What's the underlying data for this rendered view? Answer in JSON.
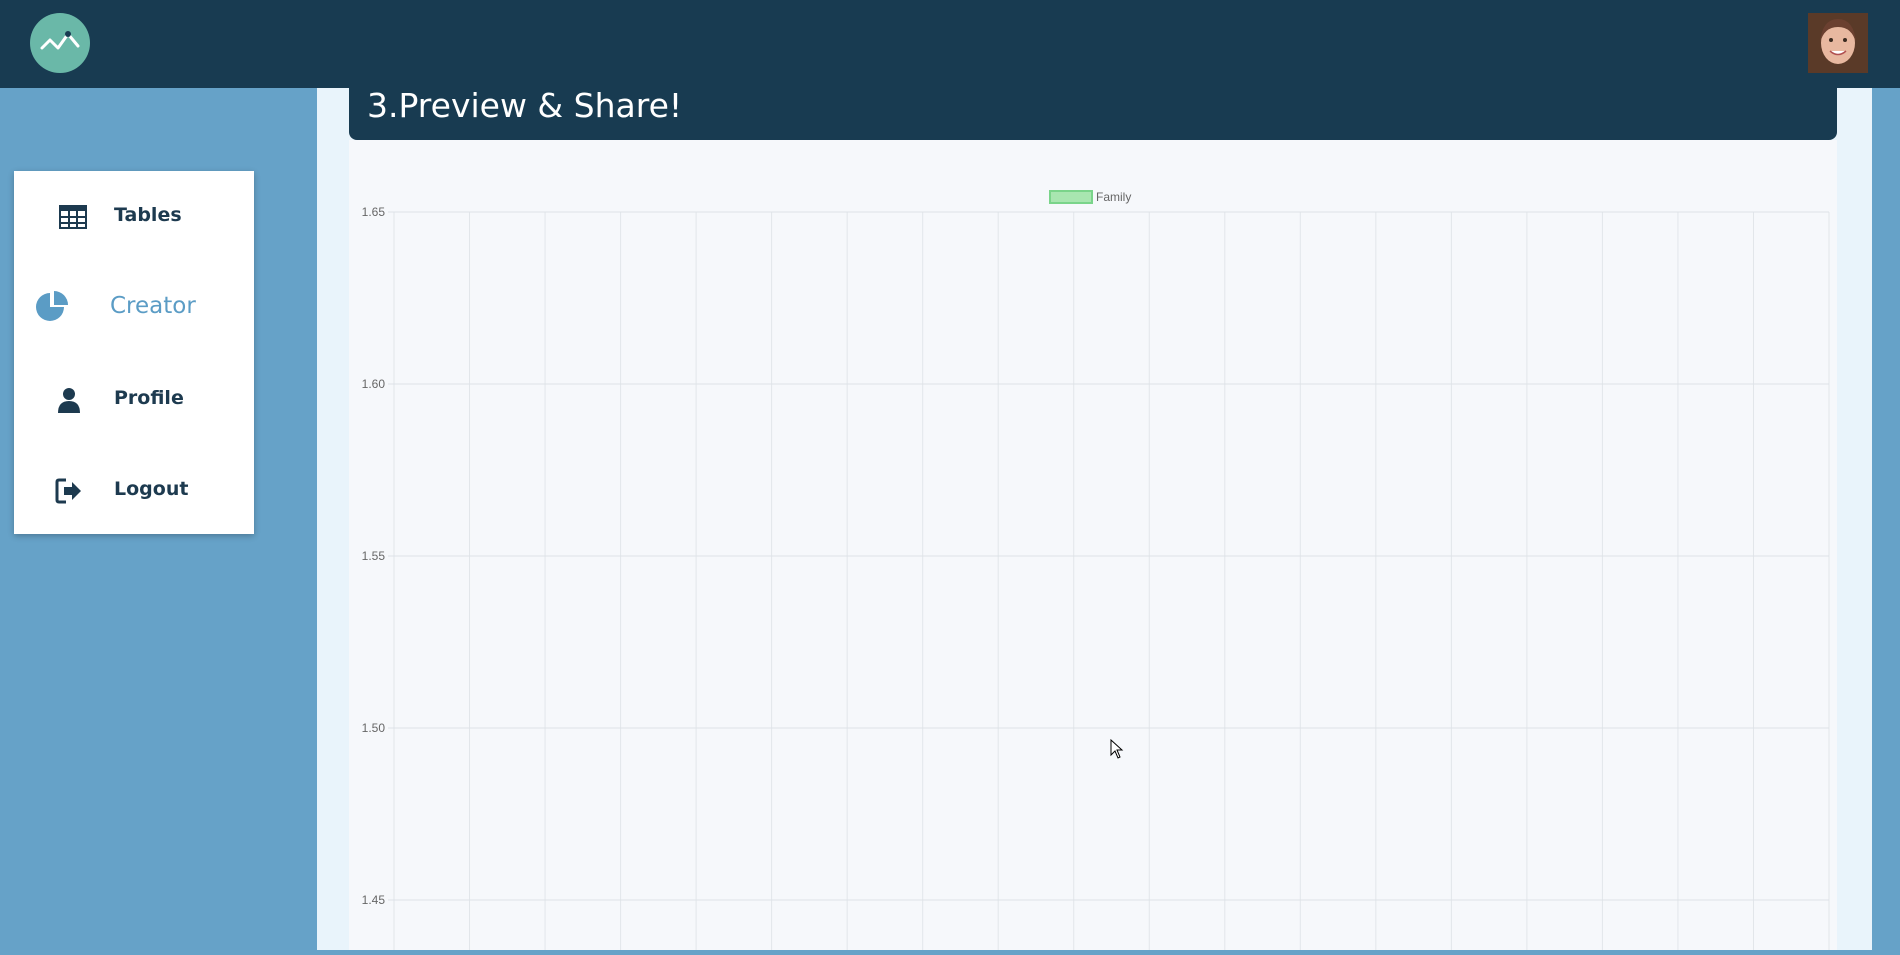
{
  "header": {
    "logo_icon": "pulse-logo-icon",
    "avatar_icon": "user-avatar-photo"
  },
  "sidebar": {
    "items": [
      {
        "label": "Tables",
        "icon": "table-icon"
      },
      {
        "label": "Creator",
        "icon": "pie-chart-icon",
        "active": true
      },
      {
        "label": "Profile",
        "icon": "user-icon"
      },
      {
        "label": "Logout",
        "icon": "logout-icon"
      }
    ]
  },
  "section": {
    "title": "3.Preview & Share!"
  },
  "colors": {
    "topbar": "#183b51",
    "background": "#66a2c8",
    "accent": "#5b9cc5",
    "series_fill": "#a8e6b0",
    "series_stroke": "#7ad48a"
  },
  "chart_data": {
    "type": "line",
    "series": [
      {
        "name": "Family",
        "values": []
      }
    ],
    "yticks": [
      "1.65",
      "1.60",
      "1.55",
      "1.50",
      "1.45"
    ],
    "ylim": [
      1.45,
      1.65
    ],
    "grid": true,
    "legend": "top-center"
  }
}
